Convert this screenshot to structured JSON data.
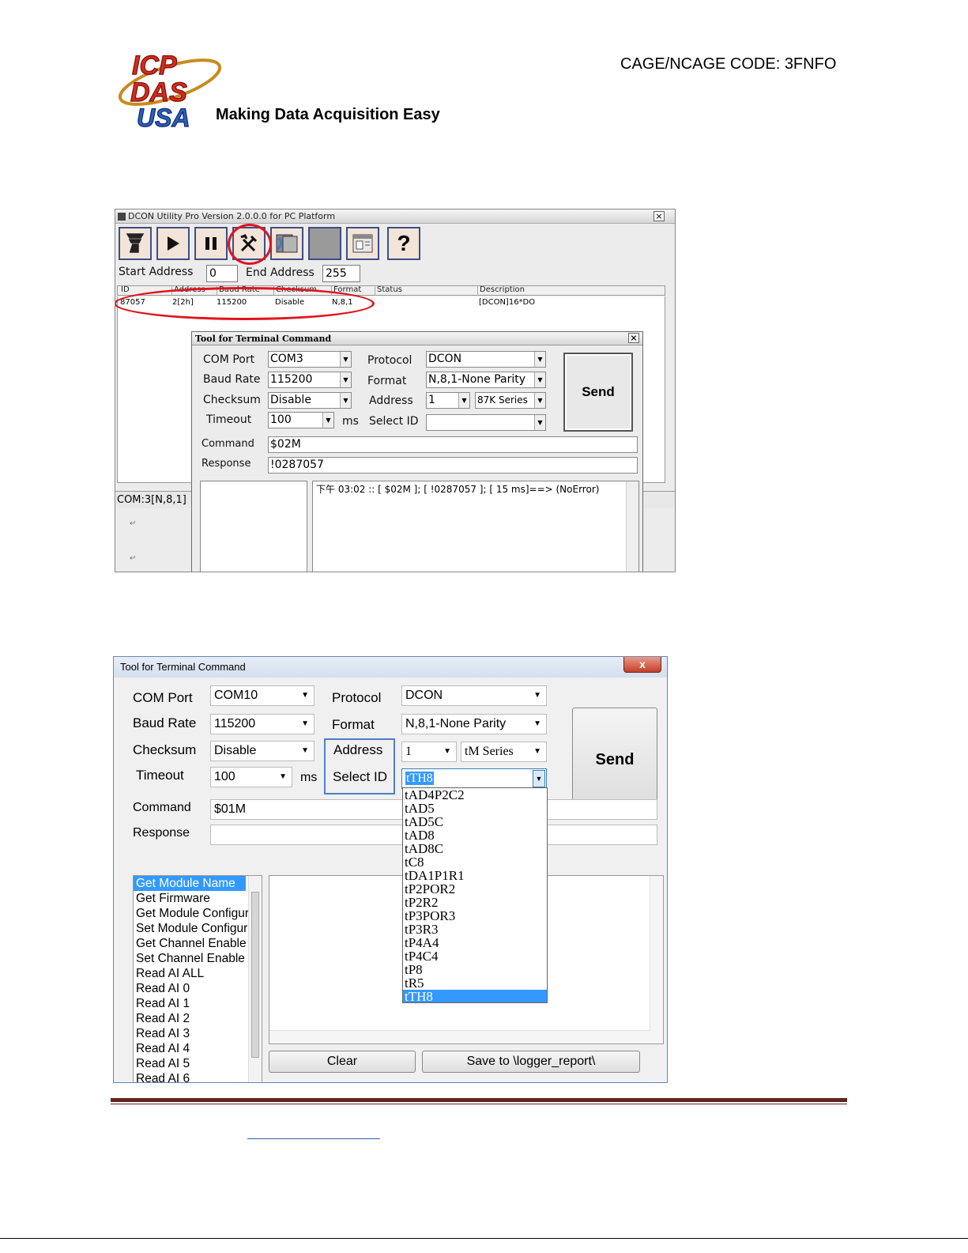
{
  "header": {
    "logo_lines": [
      "ICP",
      "DAS",
      "USA"
    ],
    "tagline": "Making Data Acquisition Easy",
    "cage_code": "CAGE/NCAGE CODE: 3FNFO"
  },
  "screenshot1": {
    "window_title": "DCON Utility Pro Version 2.0.0.0 for PC Platform",
    "close_glyph": "×",
    "toolbar_icons": [
      "scan-icon",
      "play-icon",
      "pause-icon",
      "tools-icon",
      "cards-icon",
      "blank-icon",
      "window-icon",
      "help-icon"
    ],
    "start_address_label": "Start Address",
    "start_address_value": "0",
    "end_address_label": "End Address",
    "end_address_value": "255",
    "columns": [
      "ID",
      "Address",
      "Baud Rate",
      "Checksum",
      "Format",
      "Status",
      "Description"
    ],
    "row": {
      "id": "87057",
      "address": "2[2h]",
      "baud": "115200",
      "checksum": "Disable",
      "format": "N,8,1",
      "status": "",
      "description": "[DCON]16*DO"
    },
    "status_bar": "COM:3[N,8,1]",
    "dialog": {
      "title": "Tool for Terminal Command",
      "com_port_label": "COM Port",
      "com_port": "COM3",
      "baud_label": "Baud Rate",
      "baud": "115200",
      "checksum_label": "Checksum",
      "checksum": "Disable",
      "timeout_label": "Timeout",
      "timeout": "100",
      "ms": "ms",
      "protocol_label": "Protocol",
      "protocol": "DCON",
      "format_label": "Format",
      "format": "N,8,1-None Parity",
      "address_label": "Address",
      "address": "1",
      "series": "87K Series",
      "select_id_label": "Select ID",
      "select_id": "",
      "send": "Send",
      "command_label": "Command",
      "command": "$02M",
      "response_label": "Response",
      "response": "!0287057",
      "log": "下午 03:02 :: [ $02M ]; [ !0287057 ]; [ 15 ms]==> (NoError)"
    },
    "return_mark": "↵"
  },
  "screenshot2": {
    "window_title": "Tool for Terminal Command",
    "close_glyph": "x",
    "com_port_label": "COM Port",
    "com_port": "COM10",
    "baud_label": "Baud Rate",
    "baud": "115200",
    "checksum_label": "Checksum",
    "checksum": "Disable",
    "timeout_label": "Timeout",
    "timeout": "100",
    "ms": "ms",
    "protocol_label": "Protocol",
    "protocol": "DCON",
    "format_label": "Format",
    "format": "N,8,1-None Parity",
    "address_label": "Address",
    "address": "1",
    "series": "tM Series",
    "select_id_label": "Select ID",
    "select_id": "tTH8",
    "send": "Send",
    "command_label": "Command",
    "command": "$01M",
    "response_label": "Response",
    "response": "",
    "commands": [
      "Get Module Name",
      "Get Firmware",
      "Get Module Configure",
      "Set Module Configure",
      "Get Channel Enable Status",
      "Set Channel Enable Status",
      "Read AI ALL",
      "Read AI 0",
      "Read AI 1",
      "Read AI 2",
      "Read AI 3",
      "Read AI 4",
      "Read AI 5",
      "Read AI 6"
    ],
    "dropdown_options": [
      "tAD4P2C2",
      "tAD5",
      "tAD5C",
      "tAD8",
      "tAD8C",
      "tC8",
      "tDA1P1R1",
      "tP2POR2",
      "tP2R2",
      "tP3POR3",
      "tP3R3",
      "tP4A4",
      "tP4C4",
      "tP8",
      "tR5",
      "tTH8"
    ],
    "clear": "Clear",
    "save": "Save to \\logger_report\\"
  },
  "colors": {
    "rule": "#622423",
    "selection": "#3399ff",
    "highlight_oval": "#e0141e",
    "highlight_box": "#4f7fc6"
  }
}
